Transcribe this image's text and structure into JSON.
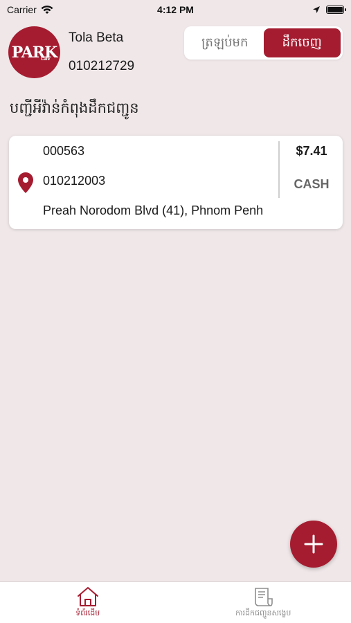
{
  "status_bar": {
    "carrier": "Carrier",
    "time": "4:12 PM",
    "battery_level": 1.0
  },
  "header": {
    "logo_text": "PARK",
    "logo_sub": "Café",
    "user_name": "Tola Beta",
    "user_phone": "010212729",
    "segments": [
      "ត្រឡប់មក",
      "ដឹកចេញ"
    ],
    "selected_segment": "ដឹកចេញ"
  },
  "section_title": "បញ្ជីអីវ៉ាន់កំពុងដឹកជញ្ជូន",
  "orders": [
    {
      "id": "000563",
      "phone": "010212003",
      "address": "Preah Norodom Blvd (41), Phnom Penh",
      "amount": "$7.41",
      "payment_method": "CASH"
    }
  ],
  "tabbar": {
    "tabs": [
      {
        "label": "ទំព័រដើម",
        "icon": "home-icon",
        "active": true
      },
      {
        "label": "ការដឹកជញ្ជូនសង្ខេប",
        "icon": "receipt-icon",
        "active": false
      }
    ]
  },
  "colors": {
    "accent": "#a51c30",
    "background": "#efe7e8"
  }
}
